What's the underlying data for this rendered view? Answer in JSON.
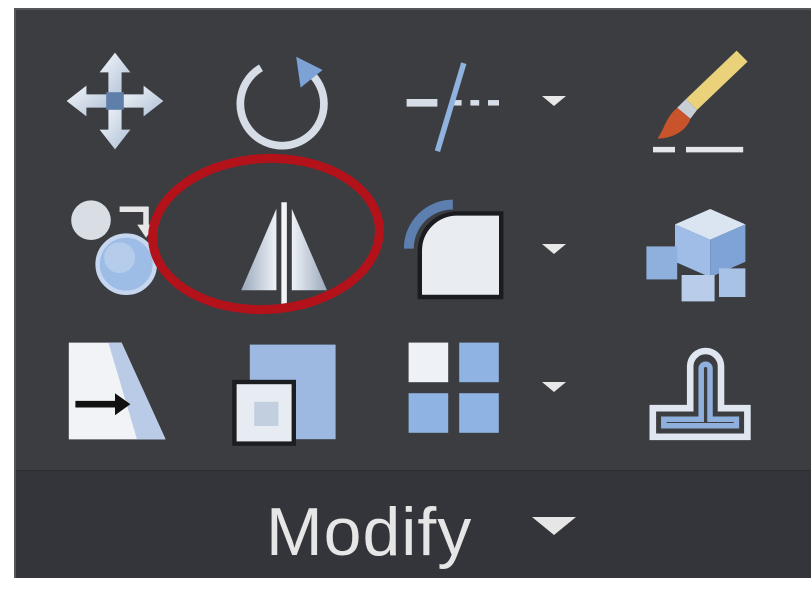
{
  "panel": {
    "label": "Modify",
    "tools": [
      {
        "name": "move",
        "icon": "move-icon"
      },
      {
        "name": "rotate",
        "icon": "rotate-icon"
      },
      {
        "name": "trim",
        "icon": "trim-icon",
        "has_dropdown": true
      },
      {
        "name": "match-properties",
        "icon": "paintbrush-icon"
      },
      {
        "name": "copy",
        "icon": "copy-icon"
      },
      {
        "name": "mirror",
        "icon": "mirror-icon",
        "highlighted": true
      },
      {
        "name": "fillet",
        "icon": "fillet-icon",
        "has_dropdown": true
      },
      {
        "name": "explode",
        "icon": "explode-icon"
      },
      {
        "name": "stretch",
        "icon": "stretch-icon"
      },
      {
        "name": "scale",
        "icon": "scale-icon"
      },
      {
        "name": "array",
        "icon": "array-icon",
        "has_dropdown": true
      },
      {
        "name": "offset",
        "icon": "offset-icon"
      }
    ]
  },
  "colors": {
    "panel_bg": "#3b3d41",
    "highlight_ring": "#b3121b",
    "icon_light": "#dde6f2",
    "icon_blue": "#8fb2de",
    "text": "#e6e6e6"
  }
}
